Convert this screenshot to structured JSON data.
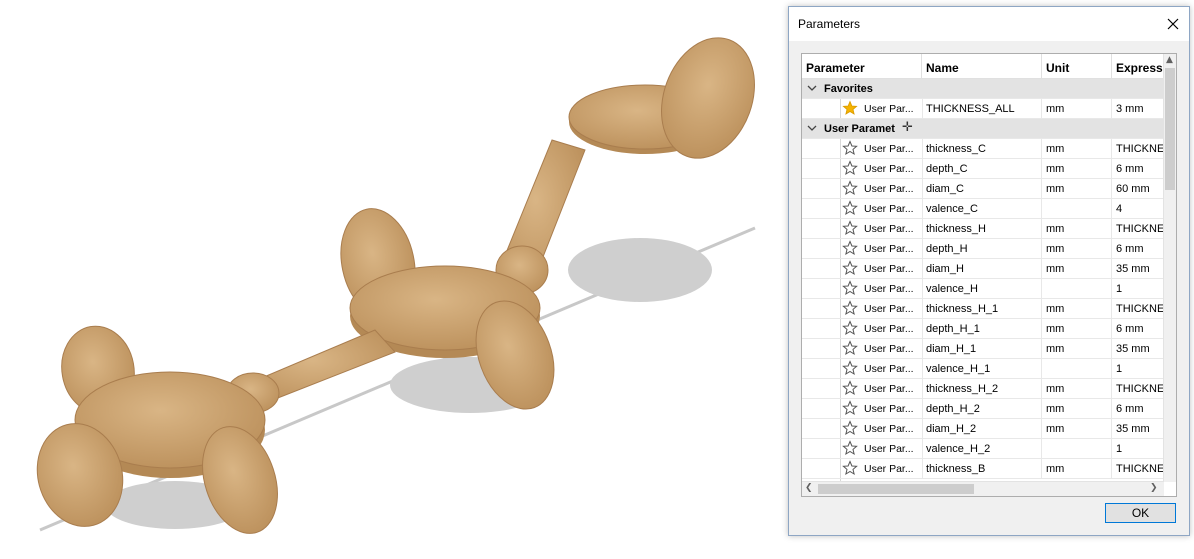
{
  "dialog": {
    "title": "Parameters",
    "columns": [
      "Parameter",
      "Name",
      "Unit",
      "Express"
    ],
    "groups": [
      {
        "label": "Favorites",
        "expanded": true,
        "rows": [
          {
            "type": "User Par...",
            "name": "THICKNESS_ALL",
            "unit": "mm",
            "expr": "3 mm",
            "favorite": true
          }
        ]
      },
      {
        "label": "User Paramet",
        "expanded": true,
        "rows": [
          {
            "type": "User Par...",
            "name": "thickness_C",
            "unit": "mm",
            "expr": "THICKNE",
            "favorite": false
          },
          {
            "type": "User Par...",
            "name": "depth_C",
            "unit": "mm",
            "expr": "6 mm",
            "favorite": false
          },
          {
            "type": "User Par...",
            "name": "diam_C",
            "unit": "mm",
            "expr": "60 mm",
            "favorite": false
          },
          {
            "type": "User Par...",
            "name": "valence_C",
            "unit": "",
            "expr": "4",
            "favorite": false
          },
          {
            "type": "User Par...",
            "name": "thickness_H",
            "unit": "mm",
            "expr": "THICKNE",
            "favorite": false
          },
          {
            "type": "User Par...",
            "name": "depth_H",
            "unit": "mm",
            "expr": "6 mm",
            "favorite": false
          },
          {
            "type": "User Par...",
            "name": "diam_H",
            "unit": "mm",
            "expr": "35 mm",
            "favorite": false
          },
          {
            "type": "User Par...",
            "name": "valence_H",
            "unit": "",
            "expr": "1",
            "favorite": false
          },
          {
            "type": "User Par...",
            "name": "thickness_H_1",
            "unit": "mm",
            "expr": "THICKNE",
            "favorite": false
          },
          {
            "type": "User Par...",
            "name": "depth_H_1",
            "unit": "mm",
            "expr": "6 mm",
            "favorite": false
          },
          {
            "type": "User Par...",
            "name": "diam_H_1",
            "unit": "mm",
            "expr": "35 mm",
            "favorite": false
          },
          {
            "type": "User Par...",
            "name": "valence_H_1",
            "unit": "",
            "expr": "1",
            "favorite": false
          },
          {
            "type": "User Par...",
            "name": "thickness_H_2",
            "unit": "mm",
            "expr": "THICKNE",
            "favorite": false
          },
          {
            "type": "User Par...",
            "name": "depth_H_2",
            "unit": "mm",
            "expr": "6 mm",
            "favorite": false
          },
          {
            "type": "User Par...",
            "name": "diam_H_2",
            "unit": "mm",
            "expr": "35 mm",
            "favorite": false
          },
          {
            "type": "User Par...",
            "name": "valence_H_2",
            "unit": "",
            "expr": "1",
            "favorite": false
          },
          {
            "type": "User Par...",
            "name": "thickness_B",
            "unit": "mm",
            "expr": "THICKNE",
            "favorite": false
          }
        ]
      }
    ],
    "ok_label": "OK"
  },
  "colors": {
    "accent": "#0078d7",
    "star_filled": "#f5b301",
    "wood": "#c9a06b"
  },
  "icons": [
    "close-icon",
    "star-icon",
    "collapse-icon",
    "scroll-up-icon",
    "scroll-left-icon",
    "scroll-right-icon",
    "move-cursor-icon"
  ]
}
